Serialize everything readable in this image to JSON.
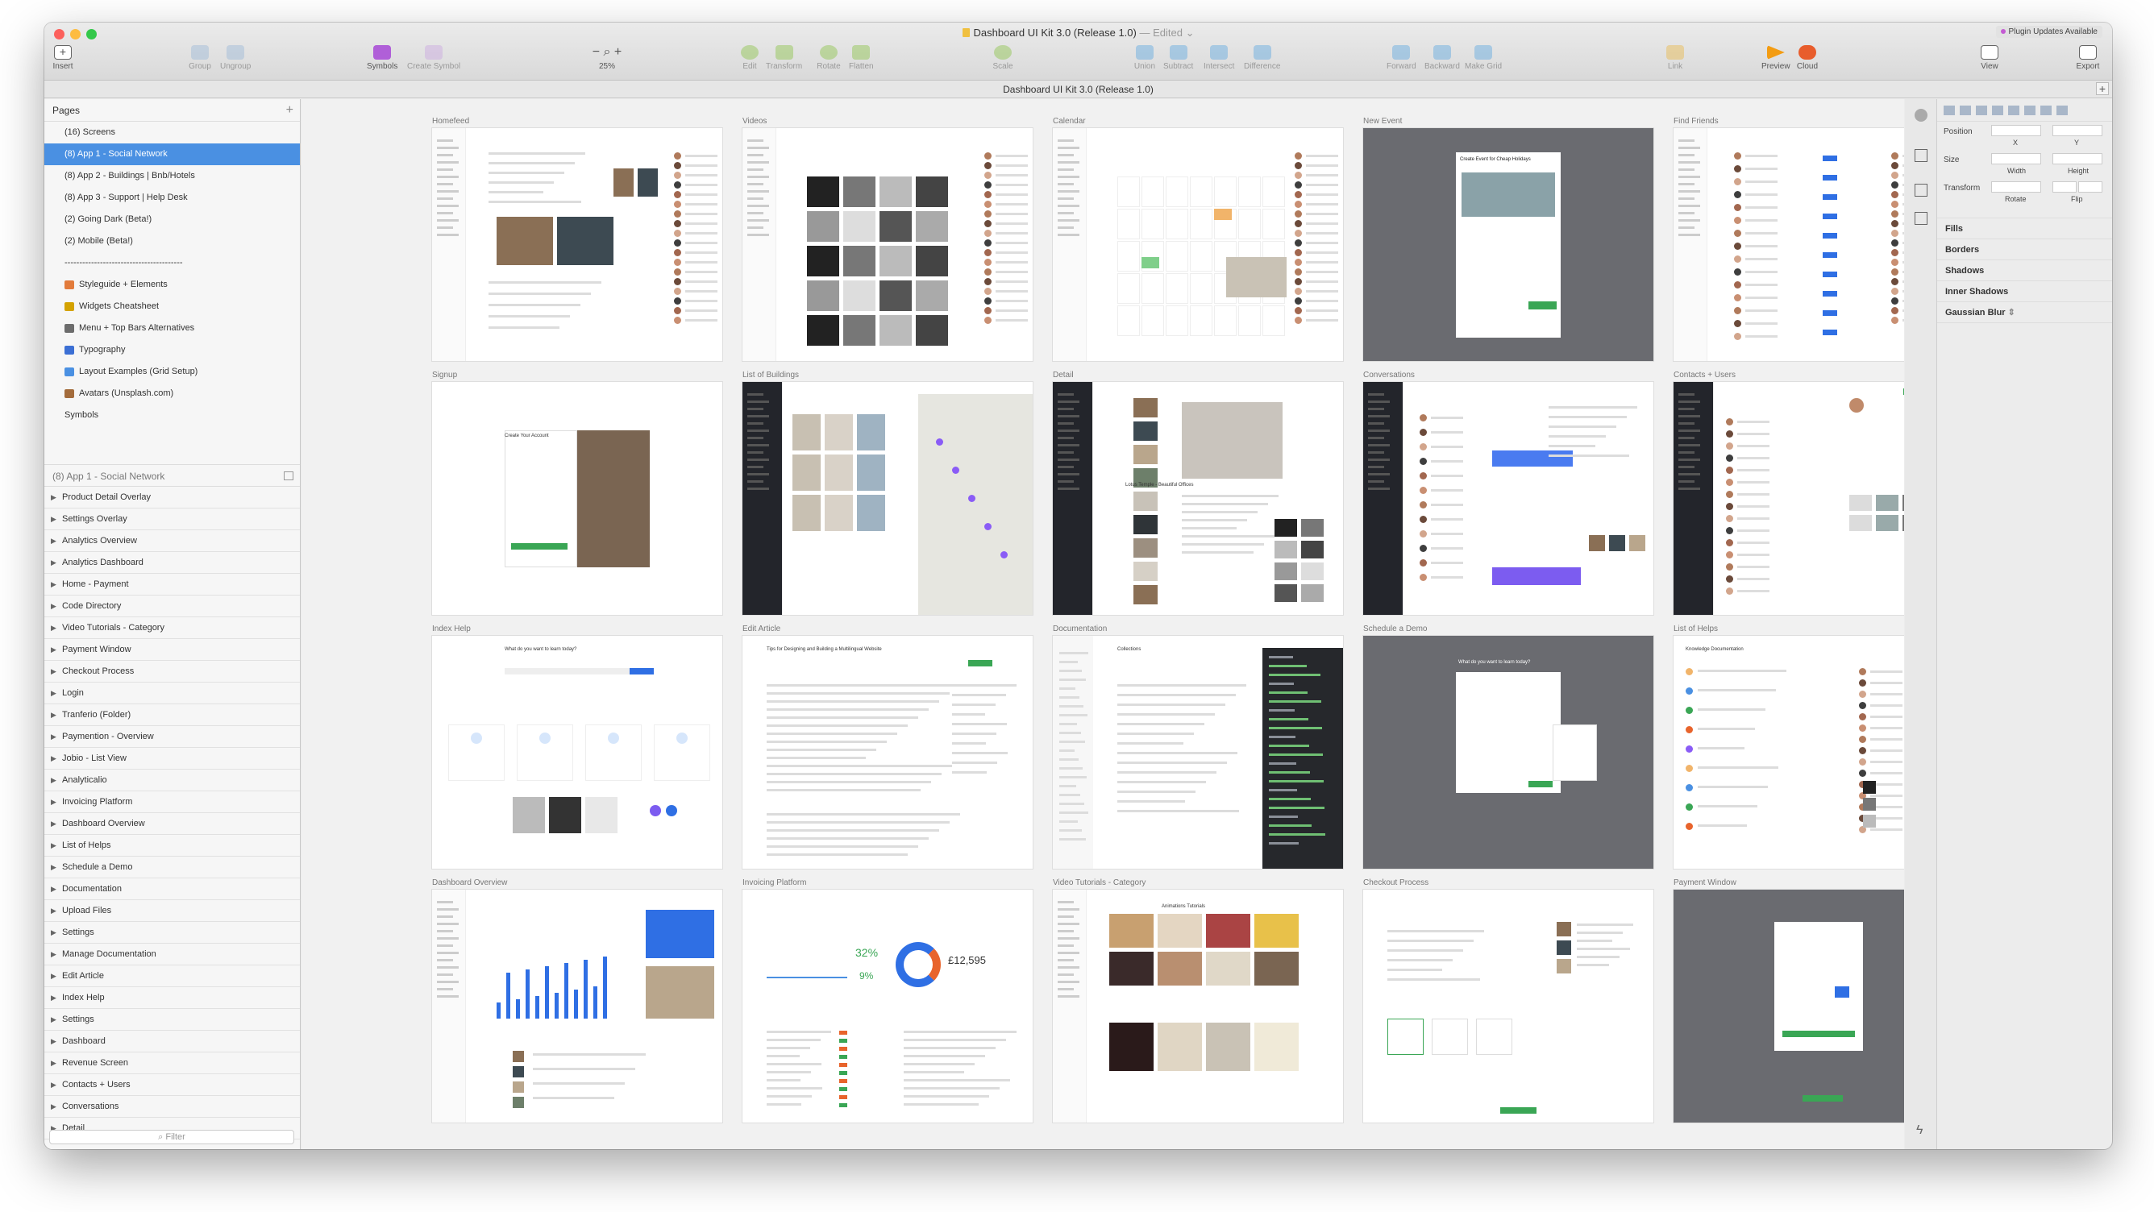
{
  "window": {
    "title": "Dashboard UI Kit 3.0 (Release 1.0)",
    "edited_label": "— Edited",
    "subtitle": "Dashboard UI Kit 3.0 (Release 1.0)",
    "plugin_badge": "Plugin Updates Available"
  },
  "toolbar": {
    "insert": "Insert",
    "group": "Group",
    "ungroup": "Ungroup",
    "symbols": "Symbols",
    "create_symbol": "Create Symbol",
    "zoom": "25%",
    "edit": "Edit",
    "transform": "Transform",
    "rotate": "Rotate",
    "flatten": "Flatten",
    "scale": "Scale",
    "union": "Union",
    "subtract": "Subtract",
    "intersect": "Intersect",
    "difference": "Difference",
    "forward": "Forward",
    "backward": "Backward",
    "make_grid": "Make Grid",
    "link": "Link",
    "preview": "Preview",
    "cloud": "Cloud",
    "view": "View",
    "export": "Export"
  },
  "pages": {
    "header": "Pages",
    "items": [
      {
        "label": "(16) Screens",
        "icon": ""
      },
      {
        "label": "(8) App 1 - Social Network",
        "icon": ""
      },
      {
        "label": "(8) App 2 - Buildings | Bnb/Hotels",
        "icon": ""
      },
      {
        "label": "(8) App 3 - Support | Help Desk",
        "icon": ""
      },
      {
        "label": "(2) Going Dark (Beta!)",
        "icon": ""
      },
      {
        "label": "(2) Mobile (Beta!)",
        "icon": ""
      },
      {
        "label": "----------------------------------------",
        "icon": ""
      },
      {
        "label": "Styleguide + Elements",
        "icon": "palette-icon"
      },
      {
        "label": "Widgets Cheatsheet",
        "icon": "widget-icon"
      },
      {
        "label": "Menu + Top Bars Alternatives",
        "icon": "menu-icon"
      },
      {
        "label": "Typography",
        "icon": "book-icon"
      },
      {
        "label": "Layout Examples (Grid Setup)",
        "icon": "grid-icon"
      },
      {
        "label": "Avatars (Unsplash.com)",
        "icon": "avatar-icon"
      },
      {
        "label": "Symbols",
        "icon": ""
      }
    ]
  },
  "layers": {
    "header": "(8) App 1 - Social Network",
    "items": [
      "Product Detail Overlay",
      "Settings Overlay",
      "Analytics Overview",
      "Analytics Dashboard",
      "Home - Payment",
      "Code Directory",
      "Video Tutorials - Category",
      "Payment Window",
      "Checkout Process",
      "Login",
      "Tranferio (Folder)",
      "Paymention - Overview",
      "Jobio - List View",
      "Analyticalio",
      "Invoicing Platform",
      "Dashboard Overview",
      "List of Helps",
      "Schedule a Demo",
      "Documentation",
      "Upload Files",
      "Settings",
      "Manage Documentation",
      "Edit Article",
      "Index Help",
      "Settings",
      "Dashboard",
      "Revenue Screen",
      "Contacts + Users",
      "Conversations",
      "Detail"
    ],
    "filter_placeholder": "Filter"
  },
  "artboards": [
    {
      "label": "Homefeed",
      "dark": false
    },
    {
      "label": "Videos",
      "dark": false
    },
    {
      "label": "Calendar",
      "dark": false
    },
    {
      "label": "New Event",
      "dark": true
    },
    {
      "label": "Find Friends",
      "dark": false
    },
    {
      "label": "Signup",
      "dark": false
    },
    {
      "label": "List of Buildings",
      "dark": false
    },
    {
      "label": "Detail",
      "dark": false
    },
    {
      "label": "Conversations",
      "dark": false
    },
    {
      "label": "Contacts + Users",
      "dark": false
    },
    {
      "label": "Index Help",
      "dark": false
    },
    {
      "label": "Edit Article",
      "dark": false
    },
    {
      "label": "Documentation",
      "dark": false
    },
    {
      "label": "Schedule a Demo",
      "dark": true
    },
    {
      "label": "List of Helps",
      "dark": false
    },
    {
      "label": "Dashboard Overview",
      "dark": false
    },
    {
      "label": "Invoicing Platform",
      "dark": false
    },
    {
      "label": "Video Tutorials - Category",
      "dark": false
    },
    {
      "label": "Checkout Process",
      "dark": false
    },
    {
      "label": "Payment Window",
      "dark": true
    }
  ],
  "artboard_details": {
    "invoicing_amount": "£12,595",
    "invoicing_pct_1": "32%",
    "invoicing_pct_2": "9%",
    "signup_title": "Create Your Account",
    "index_help_title": "What do you want to learn today?",
    "schedule_title": "What do you want to learn today?",
    "new_event_title": "Create Event for Cheap Holidays",
    "documentation_title": "Collections",
    "detail_title": "Lotus Temple - Beautiful Offices",
    "edit_article_title": "Tips for Designing and Building a Multilingual Website",
    "video_tutorials_title": "Animations Tutorials",
    "knowledge_title": "Knowledge Documentation"
  },
  "inspector": {
    "position": "Position",
    "x": "X",
    "y": "Y",
    "size": "Size",
    "width": "Width",
    "height": "Height",
    "transform": "Transform",
    "rotate": "Rotate",
    "flip": "Flip",
    "fills": "Fills",
    "borders": "Borders",
    "shadows": "Shadows",
    "inner_shadows": "Inner Shadows",
    "gaussian_blur": "Gaussian Blur"
  },
  "colors": {
    "selection": "#4a90e2",
    "accent_blue": "#2f6fe4",
    "accent_green": "#3aa655",
    "dark_board": "#6a6b70"
  }
}
